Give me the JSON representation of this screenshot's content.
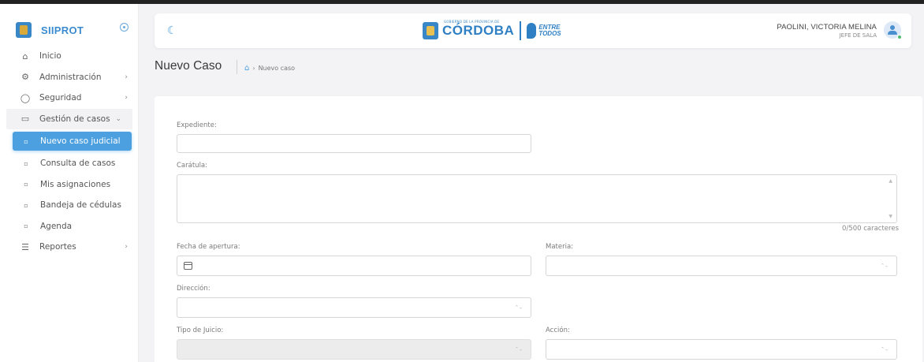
{
  "app": {
    "name": "SIIPROT"
  },
  "sidebar": {
    "items": [
      {
        "label": "Inicio",
        "icon": "home-icon",
        "glyph": "⌂"
      },
      {
        "label": "Administración",
        "icon": "gear-icon",
        "glyph": "⚙",
        "arrow": "›"
      },
      {
        "label": "Seguridad",
        "icon": "shield-icon",
        "glyph": "◯",
        "arrow": "›"
      },
      {
        "label": "Gestión de casos",
        "icon": "folder-icon",
        "glyph": "▭",
        "arrow": "⌄"
      }
    ],
    "subitems": [
      {
        "label": "Nuevo caso judicial",
        "glyph": "▫"
      },
      {
        "label": "Consulta de casos",
        "glyph": "▫"
      },
      {
        "label": "Mis asignaciones",
        "glyph": "▫"
      },
      {
        "label": "Bandeja de cédulas",
        "glyph": "▫"
      },
      {
        "label": "Agenda",
        "glyph": "▫"
      }
    ],
    "reportes": {
      "label": "Reportes",
      "glyph": "☰",
      "arrow": "›"
    }
  },
  "header": {
    "theme_glyph": "☾",
    "logo_small": "GOBIERNO DE LA PROVINCIA DE",
    "logo_word": "CÓRDOBA",
    "logo_slogan_1": "ENTRE",
    "logo_slogan_2": "TODOS",
    "user_name": "PAOLINI, VICTORIA MELINA",
    "user_role": "JEFE DE SALA"
  },
  "page": {
    "title": "Nuevo Caso",
    "breadcrumb_home": "⌂",
    "breadcrumb_arrow": "›",
    "breadcrumb_current": "Nuevo caso"
  },
  "form": {
    "expediente_label": "Expediente:",
    "expediente_value": "",
    "caratula_label": "Carátula:",
    "caratula_value": "",
    "caratula_counter": "0/500 caracteres",
    "fecha_label": "Fecha de apertura:",
    "materia_label": "Materia:",
    "direccion_label": "Dirección:",
    "tipo_label": "Tipo de Juicio:",
    "accion_label": "Acción:",
    "select_arrow": "⌃⌄"
  },
  "colors": {
    "accent": "#4da0e0",
    "brand": "#3a8bcf",
    "online": "#4cbb6c"
  }
}
